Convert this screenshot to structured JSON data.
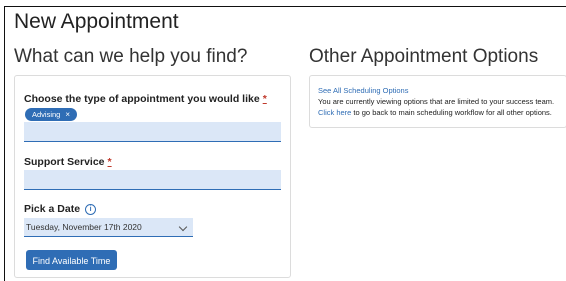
{
  "page": {
    "title": "New Appointment"
  },
  "left": {
    "heading": "What can we help you find?",
    "type_field": {
      "label": "Choose the type of appointment you would like",
      "required_mark": "*",
      "selected_tag": "Advising",
      "remove_glyph": "×"
    },
    "service_field": {
      "label": "Support Service",
      "required_mark": "*"
    },
    "date_field": {
      "label": "Pick a Date",
      "info_glyph": "i",
      "value": "Tuesday, November 17th 2020"
    },
    "find_button": "Find Available Time"
  },
  "right": {
    "heading": "Other Appointment Options",
    "see_all_link": "See All Scheduling Options",
    "info_line": "You are currently viewing options that are limited to your success team.",
    "click_here": "Click here",
    "back_text": " to go back to main scheduling workflow for all other options."
  },
  "colors": {
    "accent": "#2f6db5",
    "field_bg": "#dbe7f7",
    "required": "#c0392b"
  }
}
